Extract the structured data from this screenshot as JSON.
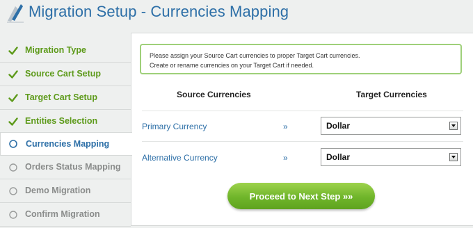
{
  "header": {
    "title": "Migration Setup - Currencies Mapping",
    "icon": "migration-logo-icon"
  },
  "sidebar": {
    "steps": [
      {
        "label": "Migration Type",
        "state": "done"
      },
      {
        "label": "Source Cart Setup",
        "state": "done"
      },
      {
        "label": "Target Cart Setup",
        "state": "done"
      },
      {
        "label": "Entities Selection",
        "state": "done"
      },
      {
        "label": "Currencies Mapping",
        "state": "active"
      },
      {
        "label": "Orders Status Mapping",
        "state": "pending"
      },
      {
        "label": "Demo Migration",
        "state": "pending"
      },
      {
        "label": "Confirm Migration",
        "state": "pending"
      }
    ]
  },
  "main": {
    "notice": {
      "line1": "Please assign your Source Cart currencies to proper Target Cart currencies.",
      "line2": "Create or rename currencies on your Target Cart if needed."
    },
    "columns": {
      "source": "Source Currencies",
      "target": "Target Currencies"
    },
    "rows": [
      {
        "label": "Primary Currency",
        "arrow": "»",
        "selected": "Dollar"
      },
      {
        "label": "Alternative Currency",
        "arrow": "»",
        "selected": "Dollar"
      }
    ],
    "proceed_label": "Proceed to Next Step »»"
  },
  "colors": {
    "accent_blue": "#2d6fa7",
    "done_green": "#5d9a1a",
    "button_green": "#6fb52a",
    "notice_border": "#9fd07a"
  }
}
